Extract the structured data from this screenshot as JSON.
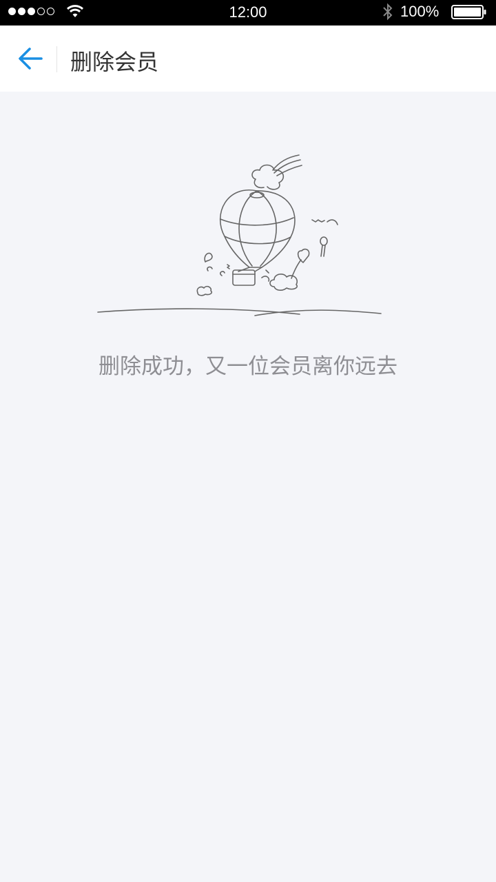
{
  "status_bar": {
    "time": "12:00",
    "battery": "100%",
    "signal_filled": 3,
    "signal_total": 5,
    "icons": [
      "signal-icon",
      "wifi-icon",
      "bluetooth-icon",
      "battery-icon"
    ]
  },
  "nav": {
    "title": "删除会员",
    "back_icon": "back-arrow-icon",
    "accent_color": "#1a8fe3"
  },
  "content": {
    "illustration": "hot-air-balloon-illustration",
    "message": "删除成功，又一位会员离你远去"
  }
}
